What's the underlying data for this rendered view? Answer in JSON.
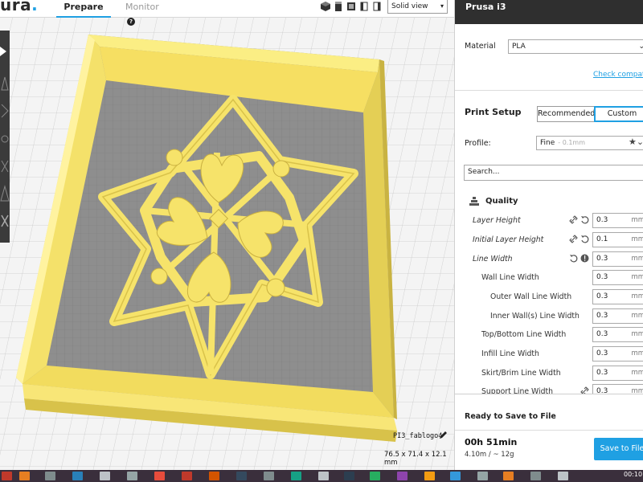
{
  "app": {
    "logo_text": "ura",
    "logo_dot": "."
  },
  "nav": {
    "prepare": "Prepare",
    "monitor": "Monitor",
    "help_glyph": "?"
  },
  "view_mode": {
    "selected": "Solid view",
    "icons": [
      "3d-view-icon",
      "front-view-icon",
      "top-view-icon",
      "left-view-icon",
      "right-view-icon"
    ]
  },
  "model": {
    "name": "PI3_fablogo4",
    "dimensions": "76.5 x 71.4 x 12.1 mm"
  },
  "panel": {
    "printer": "Prusa i3",
    "material_label": "Material",
    "material_value": "PLA",
    "check_link": "Check compatibili",
    "print_setup_title": "Print Setup",
    "recommended": "Recommended",
    "custom": "Custom",
    "profile_label": "Profile:",
    "profile_value": "Fine",
    "profile_sub": "- 0.1mm",
    "search_placeholder": "Search...",
    "section_quality": "Quality"
  },
  "settings": [
    {
      "name": "Layer Height",
      "value": "0.3",
      "unit": "mm"
    },
    {
      "name": "Initial Layer Height",
      "value": "0.1",
      "unit": "mm"
    },
    {
      "name": "Line Width",
      "value": "0.3",
      "unit": "mm"
    },
    {
      "name": "Wall Line Width",
      "value": "0.3",
      "unit": "mm"
    },
    {
      "name": "Outer Wall Line Width",
      "value": "0.3",
      "unit": "mm"
    },
    {
      "name": "Inner Wall(s) Line Width",
      "value": "0.3",
      "unit": "mm"
    },
    {
      "name": "Top/Bottom Line Width",
      "value": "0.3",
      "unit": "mm"
    },
    {
      "name": "Infill Line Width",
      "value": "0.3",
      "unit": "mm"
    },
    {
      "name": "Skirt/Brim Line Width",
      "value": "0.3",
      "unit": "mm"
    },
    {
      "name": "Support Line Width",
      "value": "0.3",
      "unit": "mm"
    }
  ],
  "output": {
    "ready": "Ready to Save to File",
    "time": "00h 51min",
    "usage": "4.10m / ~ 12g",
    "save_button": "Save to File"
  },
  "taskbar": {
    "clock": "00:10"
  },
  "colors": {
    "accent": "#1fa0e3",
    "model_yellow": "#f6e36a",
    "model_shadow": "#d9c24a",
    "build_plate": "#f2f2f2",
    "panel_header": "#2f2f2f"
  }
}
